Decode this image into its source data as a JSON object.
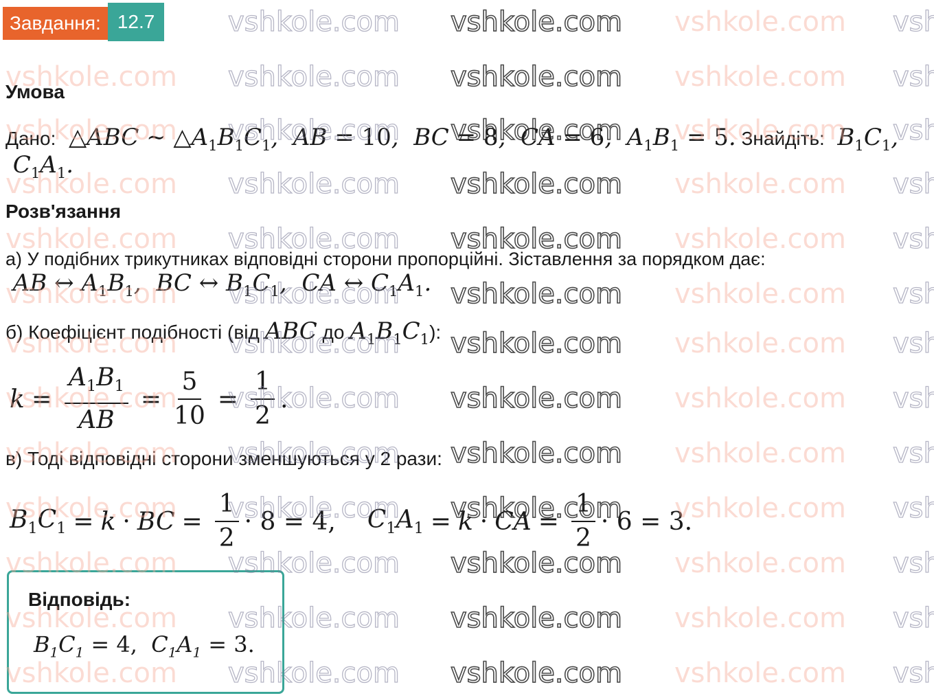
{
  "badge": {
    "label": "Завдання:",
    "number": "12.7"
  },
  "watermark": "vshkole.com",
  "condition": {
    "heading": "Умова",
    "given_label": "Дано:",
    "find_label": "Знайдіть:"
  },
  "solution": {
    "heading": "Розв'язання",
    "step_a": "а) У подібних трикутниках відповідні сторони пропорційні. Зіставлення за порядком дає:",
    "step_b_prefix": "б) Коефіцієнт подібності (від",
    "step_b_mid": "до",
    "step_b_suffix": "):",
    "step_c": "в) Тоді відповідні сторони зменшуються у 2 рази:"
  },
  "answer": {
    "heading": "Відповідь:"
  },
  "colors": {
    "badge_orange": "#e8642c",
    "badge_teal": "#3aa698",
    "answer_border": "#3aa698"
  }
}
